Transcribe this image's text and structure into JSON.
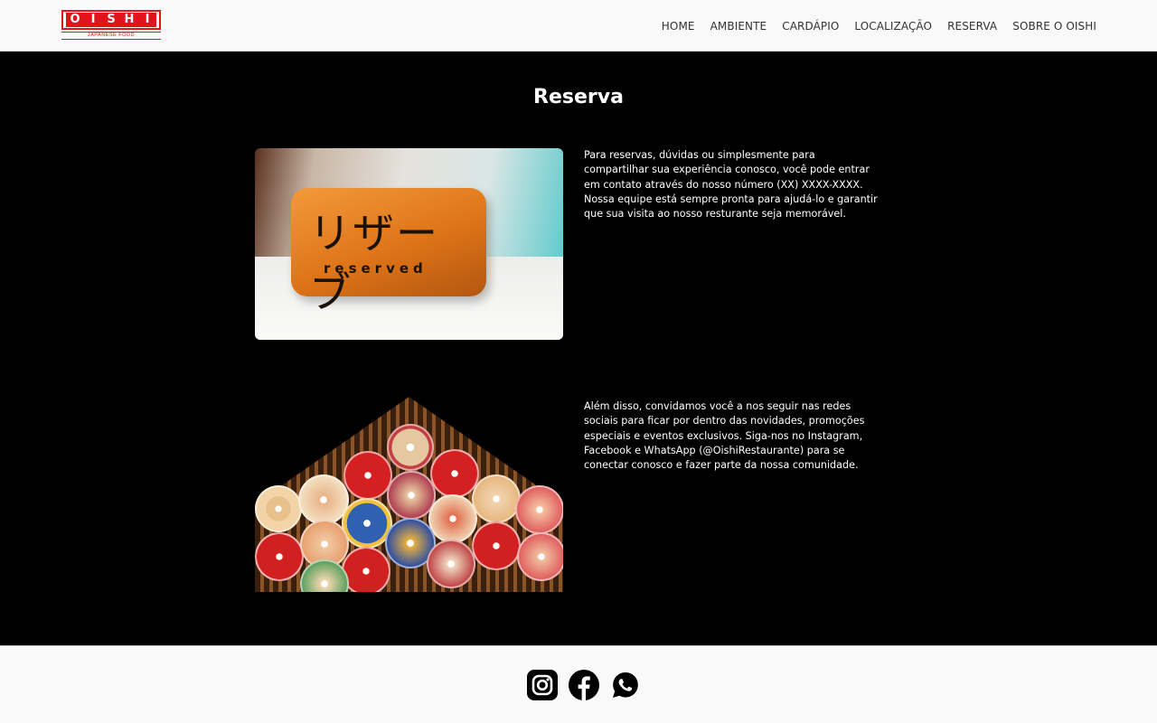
{
  "header": {
    "logo_text": "OISHI",
    "logo_sub": "JAPANESE FOOD",
    "nav": [
      "HOME",
      "AMBIENTE",
      "CARDÁPIO",
      "LOCALIZAÇÃO",
      "RESERVA",
      "SOBRE O OISHI"
    ]
  },
  "main": {
    "title": "Reserva",
    "image1": {
      "jp_text": "リザーブ",
      "en_text": "reserved"
    },
    "paragraph1": "Para reservas, dúvidas ou simplesmente para compartilhar sua experiência conosco, você pode entrar em contato através do nosso número (XX) XXXX-XXXX. Nossa equipe está sempre pronta para ajudá-lo e garantir que sua visita ao nosso resturante seja memorável.",
    "paragraph2": "Além disso, convidamos você a nos seguir nas redes sociais para ficar por dentro das novidades, promoções especiais e eventos exclusivos. Siga-nos no Instagram, Facebook e WhatsApp (@OishiRestaurante) para se conectar conosco e fazer parte da nossa comunidade."
  },
  "footer": {
    "socials": [
      "instagram-icon",
      "facebook-icon",
      "whatsapp-icon"
    ]
  },
  "colors": {
    "brand_red": "#e0141b",
    "main_bg": "#000000",
    "header_bg": "#f9f9f9"
  }
}
